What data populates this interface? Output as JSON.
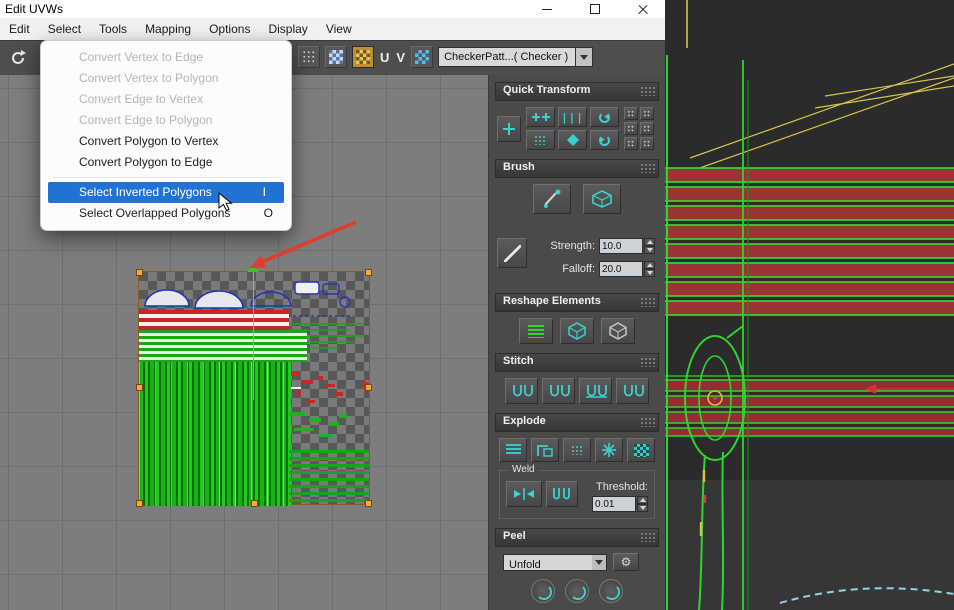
{
  "window": {
    "title": "Edit UVWs"
  },
  "menubar": {
    "items": [
      {
        "label": "Edit"
      },
      {
        "label": "Select"
      },
      {
        "label": "Tools"
      },
      {
        "label": "Mapping"
      },
      {
        "label": "Options"
      },
      {
        "label": "Display"
      },
      {
        "label": "View"
      }
    ]
  },
  "toolbar": {
    "u": "U",
    "v": "V",
    "texture_selector": "CheckerPatt...( Checker )"
  },
  "select_menu": {
    "items": [
      {
        "label": "Convert Vertex to Edge",
        "shortcut": "",
        "enabled": false,
        "highlighted": false
      },
      {
        "label": "Convert Vertex to Polygon",
        "shortcut": "",
        "enabled": false,
        "highlighted": false
      },
      {
        "label": "Convert Edge to Vertex",
        "shortcut": "",
        "enabled": false,
        "highlighted": false
      },
      {
        "label": "Convert Edge to Polygon",
        "shortcut": "",
        "enabled": false,
        "highlighted": false
      },
      {
        "label": "Convert Polygon to Vertex",
        "shortcut": "",
        "enabled": true,
        "highlighted": false
      },
      {
        "label": "Convert Polygon to Edge",
        "shortcut": "",
        "enabled": true,
        "highlighted": false
      },
      {
        "label": "Select Inverted Polygons",
        "shortcut": "I",
        "enabled": true,
        "highlighted": true
      },
      {
        "label": "Select Overlapped Polygons",
        "shortcut": "O",
        "enabled": true,
        "highlighted": false
      }
    ]
  },
  "panel": {
    "sections": {
      "quick_transform": "Quick Transform",
      "brush": "Brush",
      "reshape": "Reshape Elements",
      "stitch": "Stitch",
      "explode": "Explode",
      "peel": "Peel"
    },
    "brush": {
      "strength_label": "Strength:",
      "strength_value": "10.0",
      "falloff_label": "Falloff:",
      "falloff_value": "20.0"
    },
    "explode": {
      "weld_label": "Weld",
      "threshold_label": "Threshold:",
      "threshold_value": "0.01"
    },
    "peel": {
      "mode": "Unfold"
    }
  },
  "icons": {
    "gear": "⚙",
    "bars": "|||"
  },
  "colors": {
    "accent_teal": "#3cd0d0",
    "highlight_blue": "#2272d4",
    "annotation_red": "#e23b2e",
    "uv_green": "#15b515",
    "slat_red": "#9c3434",
    "wire_green": "#2fd52f",
    "frame_yellow": "#d6c64a"
  }
}
